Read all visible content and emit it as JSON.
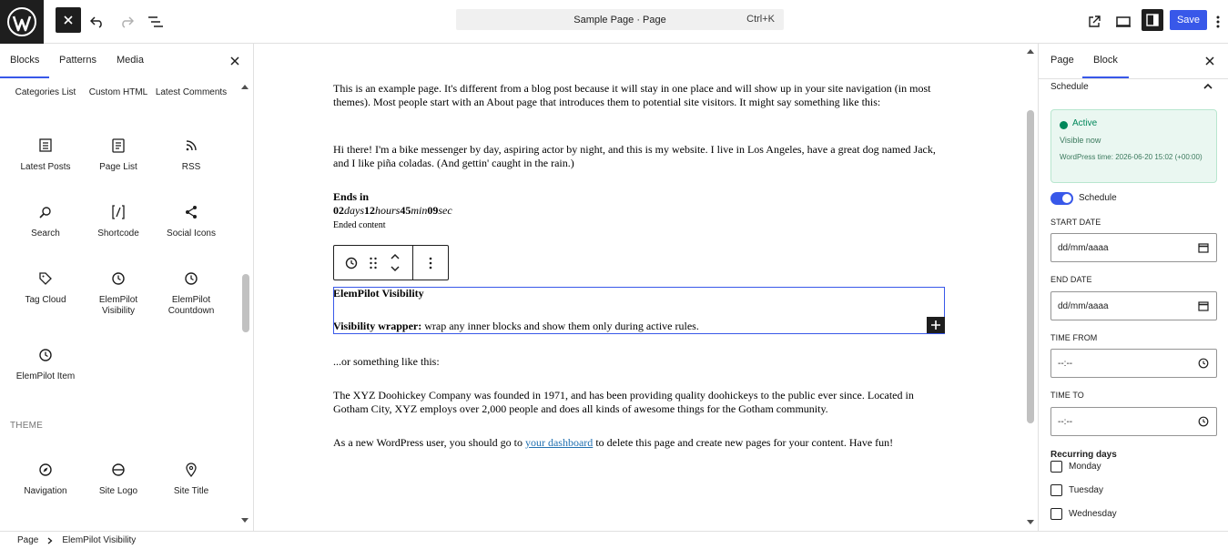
{
  "topbar": {
    "doc_title": "Sample Page · Page",
    "shortcut": "Ctrl+K",
    "save_label": "Save"
  },
  "inserter": {
    "tabs": [
      "Blocks",
      "Patterns",
      "Media"
    ],
    "row0": [
      "Categories List",
      "Custom HTML",
      "Latest Comments"
    ],
    "row1": [
      "Latest Posts",
      "Page List",
      "RSS"
    ],
    "row2": [
      "Search",
      "Shortcode",
      "Social Icons"
    ],
    "row3": [
      "Tag Cloud",
      "ElemPilot Visibility",
      "ElemPilot Countdown"
    ],
    "row4": [
      "ElemPilot Item"
    ],
    "theme_label": "THEME",
    "row5": [
      "Navigation",
      "Site Logo",
      "Site Title"
    ]
  },
  "canvas": {
    "p1": "This is an example page. It's different from a blog post because it will stay in one place and will show up in your site navigation (in most themes). Most people start with an About page that introduces them to potential site visitors. It might say something like this:",
    "p2": "Hi there! I'm a bike messenger by day, aspiring actor by night, and this is my website. I live in Los Angeles, have a great dog named Jack, and I like piña coladas. (And gettin' caught in the rain.)",
    "ends_in": "Ends in",
    "countdown": {
      "days": "02",
      "days_unit": "days",
      "hours": "12",
      "hours_unit": "hours",
      "mins": "45",
      "mins_unit": "min",
      "secs": "09",
      "secs_unit": "sec"
    },
    "ended_content": "Ended content",
    "block_title": "ElemPilot Visibility",
    "wrapper_strong": "Visibility wrapper:",
    "wrapper_rest": " wrap any inner blocks and show them only during active rules.",
    "p3": "...or something like this:",
    "p4": "The XYZ Doohickey Company was founded in 1971, and has been providing quality doohickeys to the public ever since. Located in Gotham City, XYZ employs over 2,000 people and does all kinds of awesome things for the Gotham community.",
    "p5_before": "As a new WordPress user, you should go to ",
    "p5_link": "your dashboard",
    "p5_after": " to delete this page and create new pages for your content. Have fun!"
  },
  "sidebar": {
    "tabs": [
      "Page",
      "Block"
    ],
    "panel_title": "Schedule",
    "status_title": "Active",
    "status_sub": "Visible now",
    "status_time": "WordPress time: 2026-06-20 15:02 (+00:00)",
    "toggle_label": "Schedule",
    "start_label": "START DATE",
    "start_value": "dd/mm/aaaa",
    "end_label": "END DATE",
    "end_value": "dd/mm/aaaa",
    "time_from_label": "TIME FROM",
    "time_from_value": "--:--",
    "time_to_label": "TIME TO",
    "time_to_value": "--:--",
    "recurring_label": "Recurring days",
    "days": [
      "Monday",
      "Tuesday",
      "Wednesday"
    ]
  },
  "footer": {
    "crumb_root": "Page",
    "crumb_current": "ElemPilot Visibility"
  },
  "colors": {
    "accent": "#3858e9",
    "active_green": "#00875a",
    "dark": "#1e1e1e"
  }
}
